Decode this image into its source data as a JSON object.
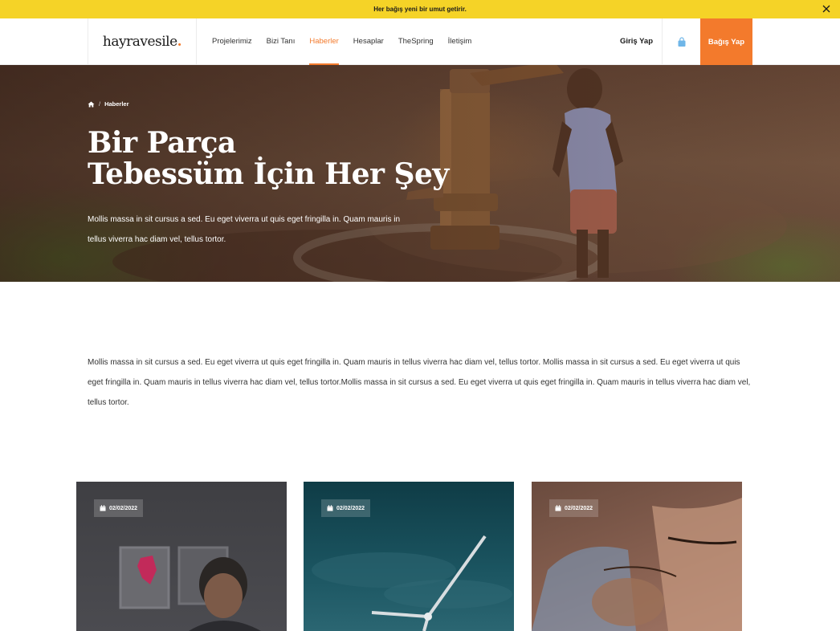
{
  "announcement": {
    "text": "Her bağış yeni bir umut getirir."
  },
  "header": {
    "logo": {
      "text": "hayravesile",
      "dot": "."
    },
    "nav": [
      {
        "label": "Projelerimiz",
        "active": false
      },
      {
        "label": "Bizi Tanı",
        "active": false
      },
      {
        "label": "Haberler",
        "active": true
      },
      {
        "label": "Hesaplar",
        "active": false
      },
      {
        "label": "TheSpring",
        "active": false
      },
      {
        "label": "İletişim",
        "active": false
      }
    ],
    "login_label": "Giriş Yap",
    "donate_label": "Bağış Yap"
  },
  "hero": {
    "breadcrumb": {
      "current": "Haberler",
      "separator": "/"
    },
    "title_line1": "Bir Parça",
    "title_line2": "Tebessüm İçin Her Şey",
    "description": "Mollis massa in sit cursus a sed. Eu eget viverra ut quis eget fringilla in. Quam mauris in tellus viverra hac diam vel, tellus tortor."
  },
  "intro": {
    "text": "Mollis massa in sit cursus a sed. Eu eget viverra ut quis eget fringilla in. Quam mauris in tellus viverra hac diam vel, tellus tortor. Mollis massa in sit cursus a sed. Eu eget viverra ut quis eget fringilla in. Quam mauris in tellus viverra hac diam vel, tellus tortor.Mollis massa in sit cursus a sed. Eu eget viverra ut quis eget fringilla in. Quam mauris in tellus viverra hac diam vel, tellus tortor."
  },
  "cards": [
    {
      "date": "02/02/2022"
    },
    {
      "date": "02/02/2022"
    },
    {
      "date": "02/02/2022"
    }
  ],
  "icons": {
    "close": "close-icon",
    "cart": "shopping-bag-icon",
    "home": "home-icon",
    "calendar": "calendar-icon"
  },
  "colors": {
    "announcement_bg": "#f5d327",
    "accent": "#f37a2c",
    "text_dark": "#1a1a1a"
  }
}
